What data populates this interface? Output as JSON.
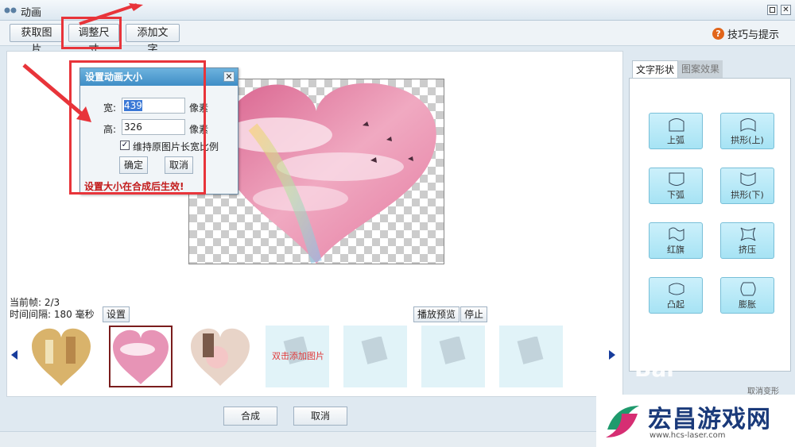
{
  "window": {
    "title": "动画"
  },
  "toolbar": {
    "get_image": "获取图片",
    "resize": "调整尺寸",
    "add_text": "添加文字",
    "tips": "技巧与提示",
    "tips_icon": "?"
  },
  "dialog": {
    "title": "设置动画大小",
    "close": "✕",
    "width_label": "宽:",
    "width_value": "439",
    "height_label": "高:",
    "height_value": "326",
    "unit": "像素",
    "keep_ratio": "维持原图片长宽比例",
    "keep_ratio_checked": true,
    "ok": "确定",
    "cancel": "取消",
    "warning": "设置大小在合成后生效!"
  },
  "frame": {
    "current_label": "当前帧: 2/3",
    "interval_label": "时间间隔: 180 毫秒",
    "set_button": "设置",
    "preview_button": "播放预览",
    "stop_button": "停止"
  },
  "thumbnails": {
    "add_text": "双击添加图片",
    "placeholder_mark": "PCIM"
  },
  "right_panel": {
    "tabs": [
      "文字形状",
      "图案效果"
    ],
    "shapes": [
      "上弧",
      "拱形(上)",
      "下弧",
      "拱形(下)",
      "红旗",
      "挤压",
      "凸起",
      "膨胀"
    ]
  },
  "bottom": {
    "compose": "合成",
    "cancel": "取消"
  },
  "watermark": {
    "text": "宏昌游戏网",
    "url": "www.hcs-laser.com",
    "baidu": "Bai",
    "baidu_btn": "取消变形"
  },
  "colors": {
    "highlight_red": "#e8343a",
    "title_blue": "#3f8dc6",
    "shape_button": "#a6e3f4"
  }
}
